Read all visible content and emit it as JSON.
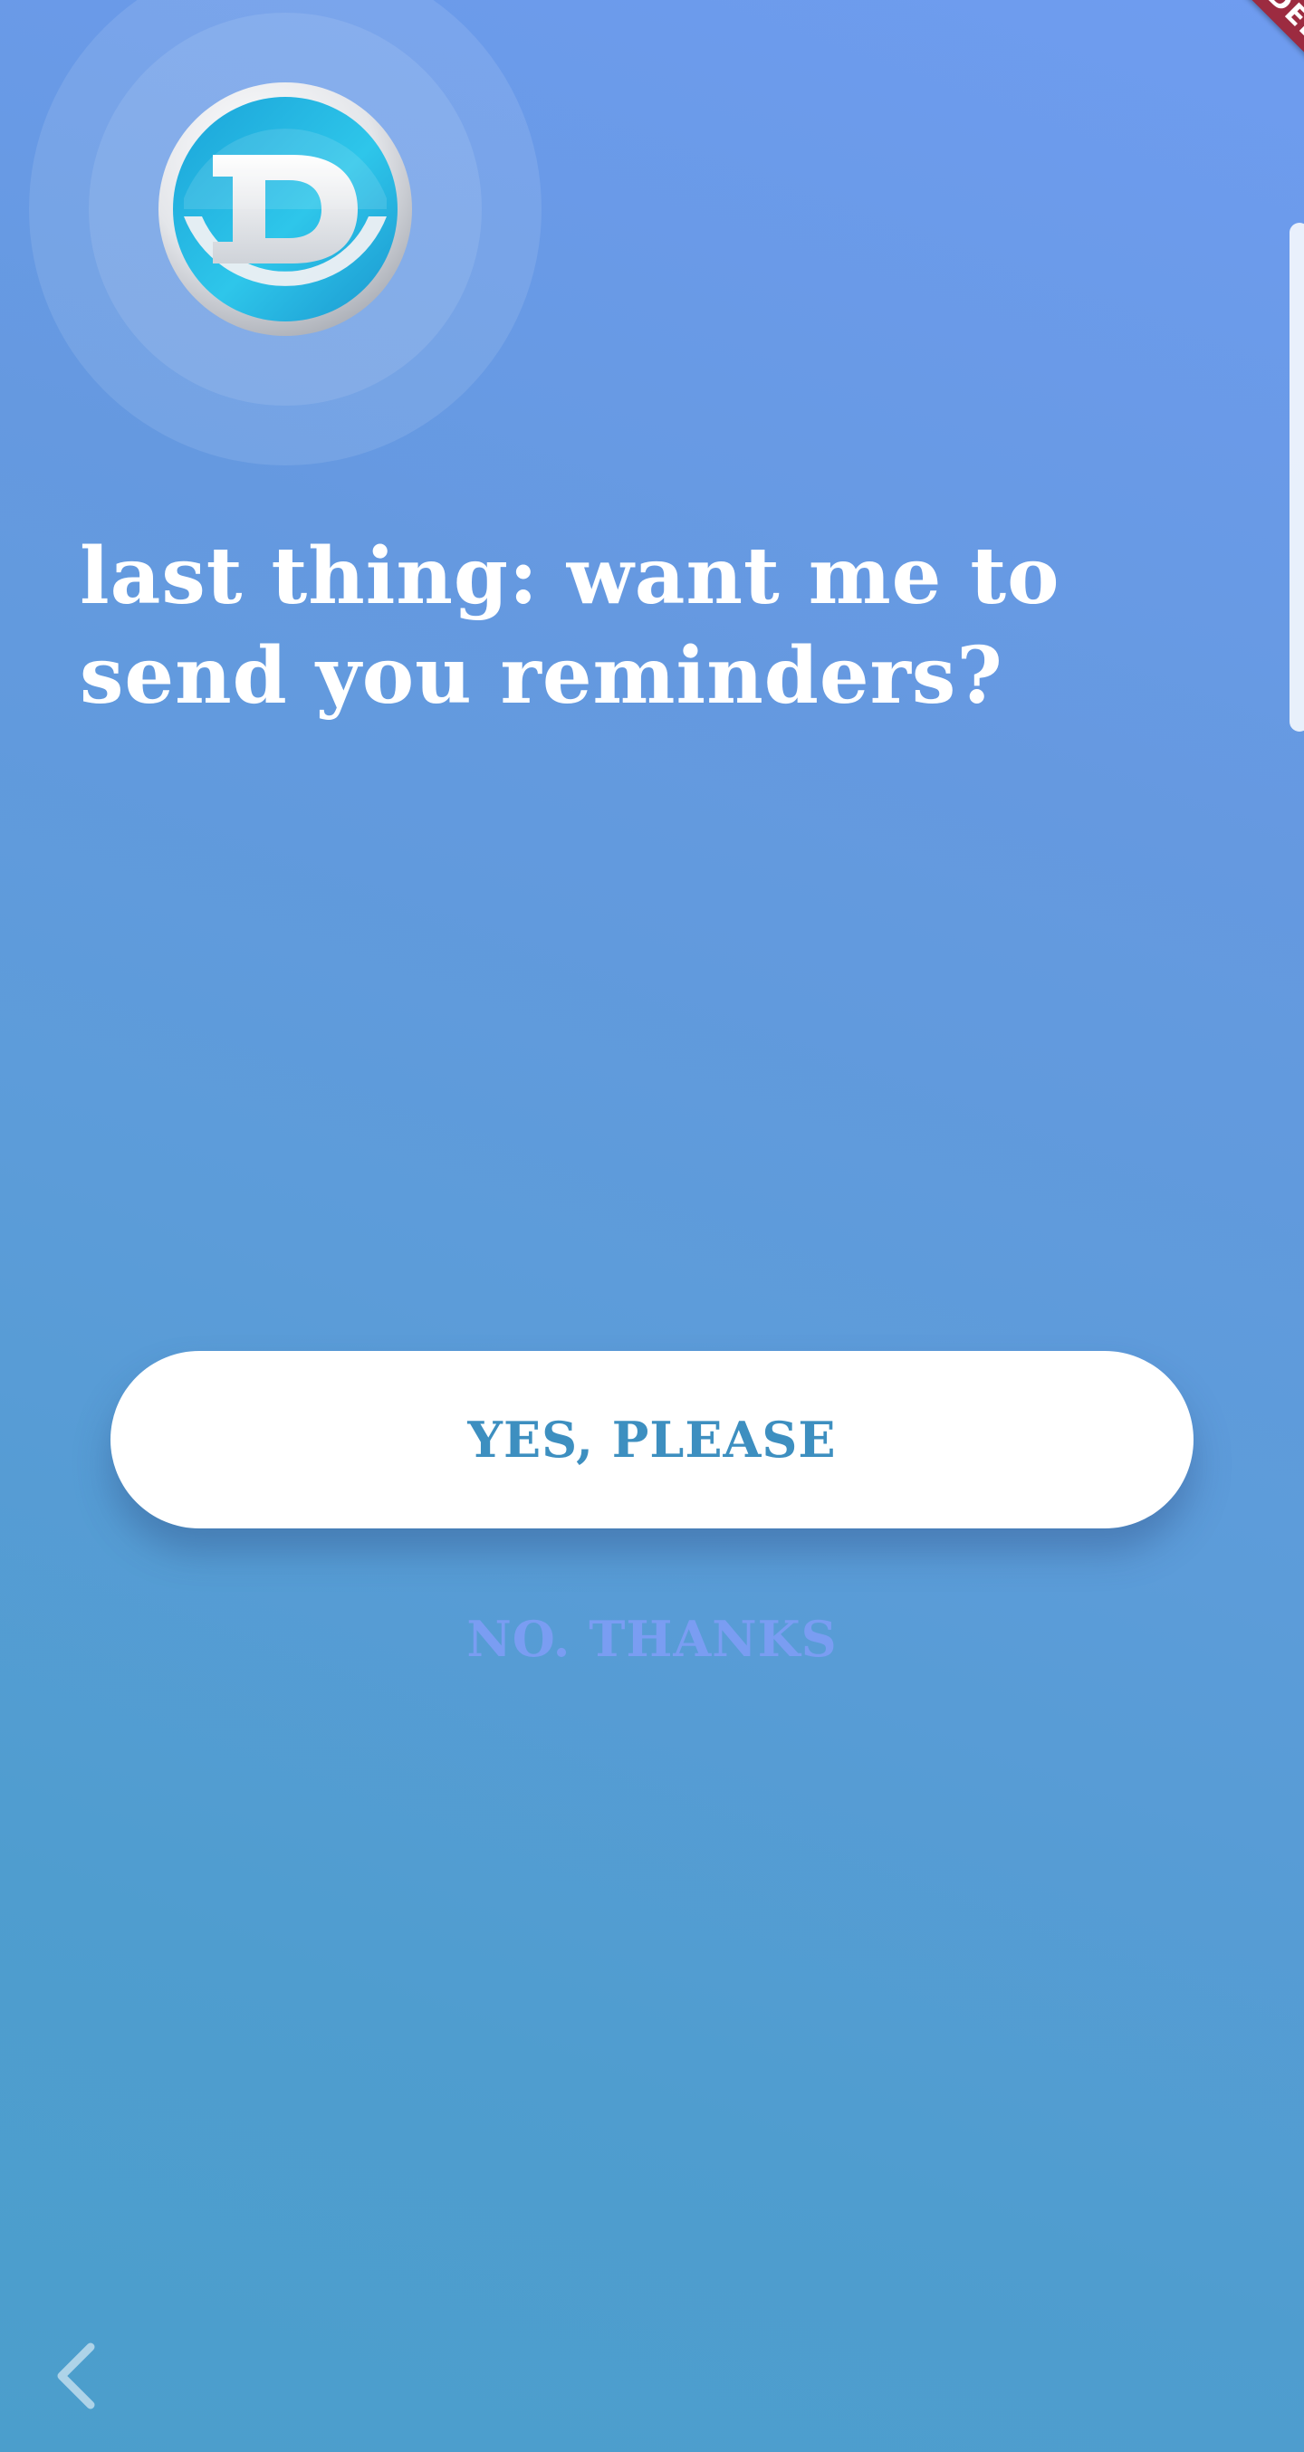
{
  "onboarding": {
    "heading": "last thing: want me to send you reminders?",
    "yes_button_label": "YES, PLEASE",
    "no_button_label": "NO. THANKS"
  },
  "logo": {
    "letter": "D",
    "icon": "d-logo-icon"
  },
  "navigation": {
    "back_icon": "chevron-left-icon"
  },
  "debug_banner": {
    "label": "DEBUG"
  },
  "colors": {
    "background_top": "#6f9cf0",
    "background_bottom": "#4b9ecc",
    "primary_button_bg": "#ffffff",
    "primary_button_text": "#3d8fc0",
    "secondary_button_text": "#7a9df2",
    "debug_ribbon": "#9c2b40"
  }
}
